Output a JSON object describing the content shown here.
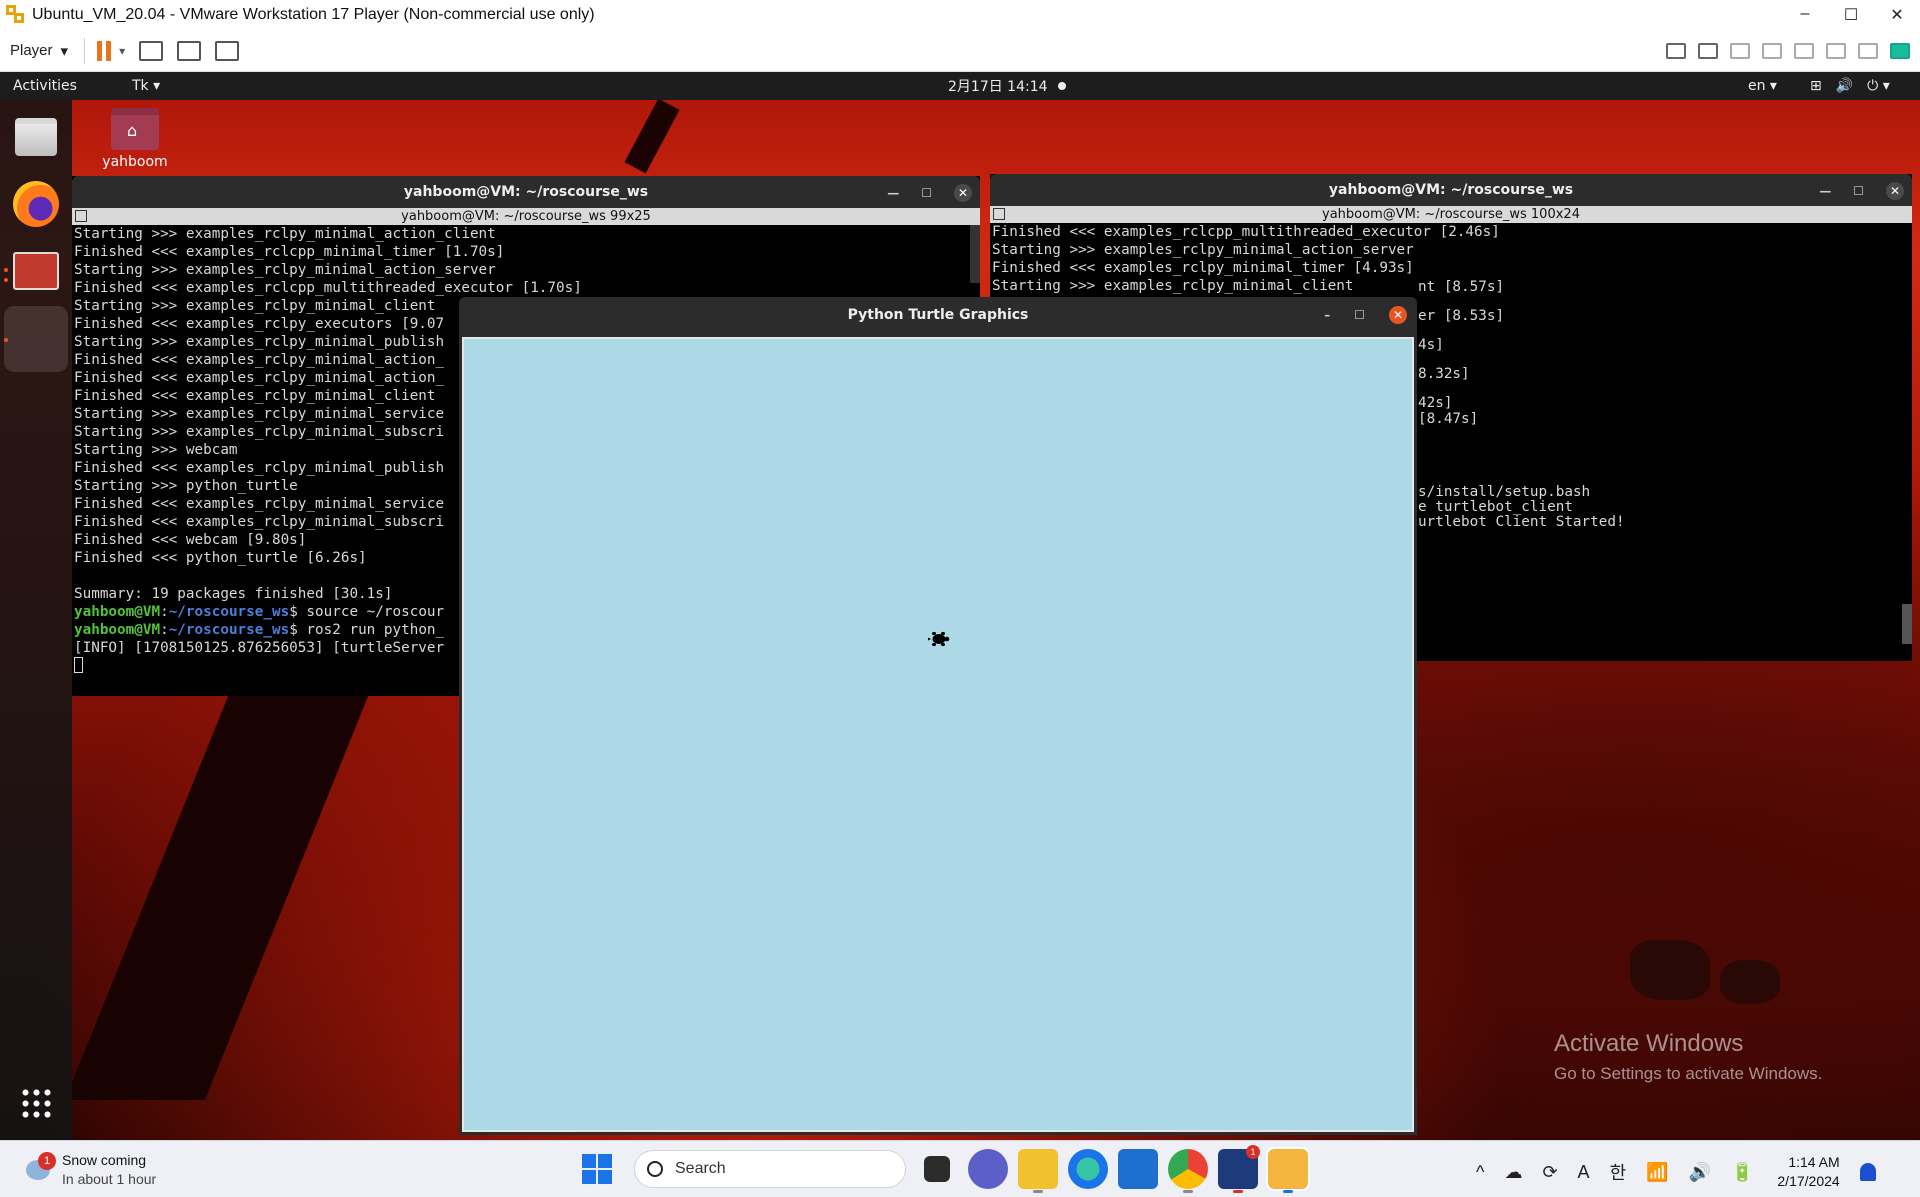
{
  "vmware": {
    "title": "Ubuntu_VM_20.04 - VMware Workstation 17 Player (Non-commercial use only)",
    "window_controls": [
      "–",
      "☐",
      "✕"
    ],
    "toolbar": {
      "player_label": "Player",
      "dropdown_arrow": "▾"
    }
  },
  "gnome": {
    "activities": "Activities",
    "app_menu": "Tk ▾",
    "clock": "2月17日 14:14",
    "language": "en ▾",
    "system_icons": [
      "⊞",
      "🔊",
      "⏻ ▾"
    ]
  },
  "desktop": {
    "home_folder_label": "yahboom",
    "watermark_title": "Activate Windows",
    "watermark_subtitle": "Go to Settings to activate Windows."
  },
  "terminal_left": {
    "title": "yahboom@VM: ~/roscourse_ws",
    "subtitle": "yahboom@VM: ~/roscourse_ws 99x25",
    "lines": [
      "Starting >>> examples_rclpy_minimal_action_client",
      "Finished <<< examples_rclcpp_minimal_timer [1.70s]",
      "Starting >>> examples_rclpy_minimal_action_server",
      "Finished <<< examples_rclcpp_multithreaded_executor [1.70s]",
      "Starting >>> examples_rclpy_minimal_client",
      "Finished <<< examples_rclpy_executors [9.07",
      "Starting >>> examples_rclpy_minimal_publish",
      "Finished <<< examples_rclpy_minimal_action_",
      "Finished <<< examples_rclpy_minimal_action_",
      "Finished <<< examples_rclpy_minimal_client",
      "Starting >>> examples_rclpy_minimal_service",
      "Starting >>> examples_rclpy_minimal_subscri",
      "Starting >>> webcam",
      "Finished <<< examples_rclpy_minimal_publish",
      "Starting >>> python_turtle",
      "Finished <<< examples_rclpy_minimal_service",
      "Finished <<< examples_rclpy_minimal_subscri",
      "Finished <<< webcam [9.80s]",
      "Finished <<< python_turtle [6.26s]",
      "",
      "Summary: 19 packages finished [30.1s]"
    ],
    "prompt_user": "yahboom@VM",
    "prompt_path": "~/roscourse_ws",
    "cmd1": "$ source ~/roscour",
    "cmd2": "$ ros2 run python_",
    "info_line": "[INFO] [1708150125.876256053] [turtleServer"
  },
  "terminal_right": {
    "title": "yahboom@VM: ~/roscourse_ws",
    "subtitle": "yahboom@VM: ~/roscourse_ws 100x24",
    "lines": [
      "Finished <<< examples_rclcpp_multithreaded_executor [2.46s]",
      "Starting >>> examples_rclpy_minimal_action_server",
      "Finished <<< examples_rclpy_minimal_timer [4.93s]",
      "Starting >>> examples_rclpy_minimal_client"
    ],
    "fragments": [
      "nt [8.57s]",
      "er [8.53s]",
      "4s]",
      "8.32s]",
      "42s]",
      "[8.47s]",
      "s/install/setup.bash",
      "e turtlebot_client",
      "urtlebot Client Started!"
    ]
  },
  "turtle_window": {
    "title": "Python Turtle Graphics",
    "controls": [
      "–",
      "☐",
      "✕"
    ],
    "canvas_color": "#add8e6"
  },
  "taskbar": {
    "weather_badge": "1",
    "weather_title": "Snow coming",
    "weather_subtitle": "In about 1 hour",
    "search_placeholder": "Search",
    "teams_badge": "1",
    "time": "1:14 AM",
    "date": "2/17/2024",
    "tray_icons": [
      "^",
      "☁",
      "⟳",
      "A",
      "한",
      "📶",
      "🔊",
      "🔋"
    ]
  }
}
